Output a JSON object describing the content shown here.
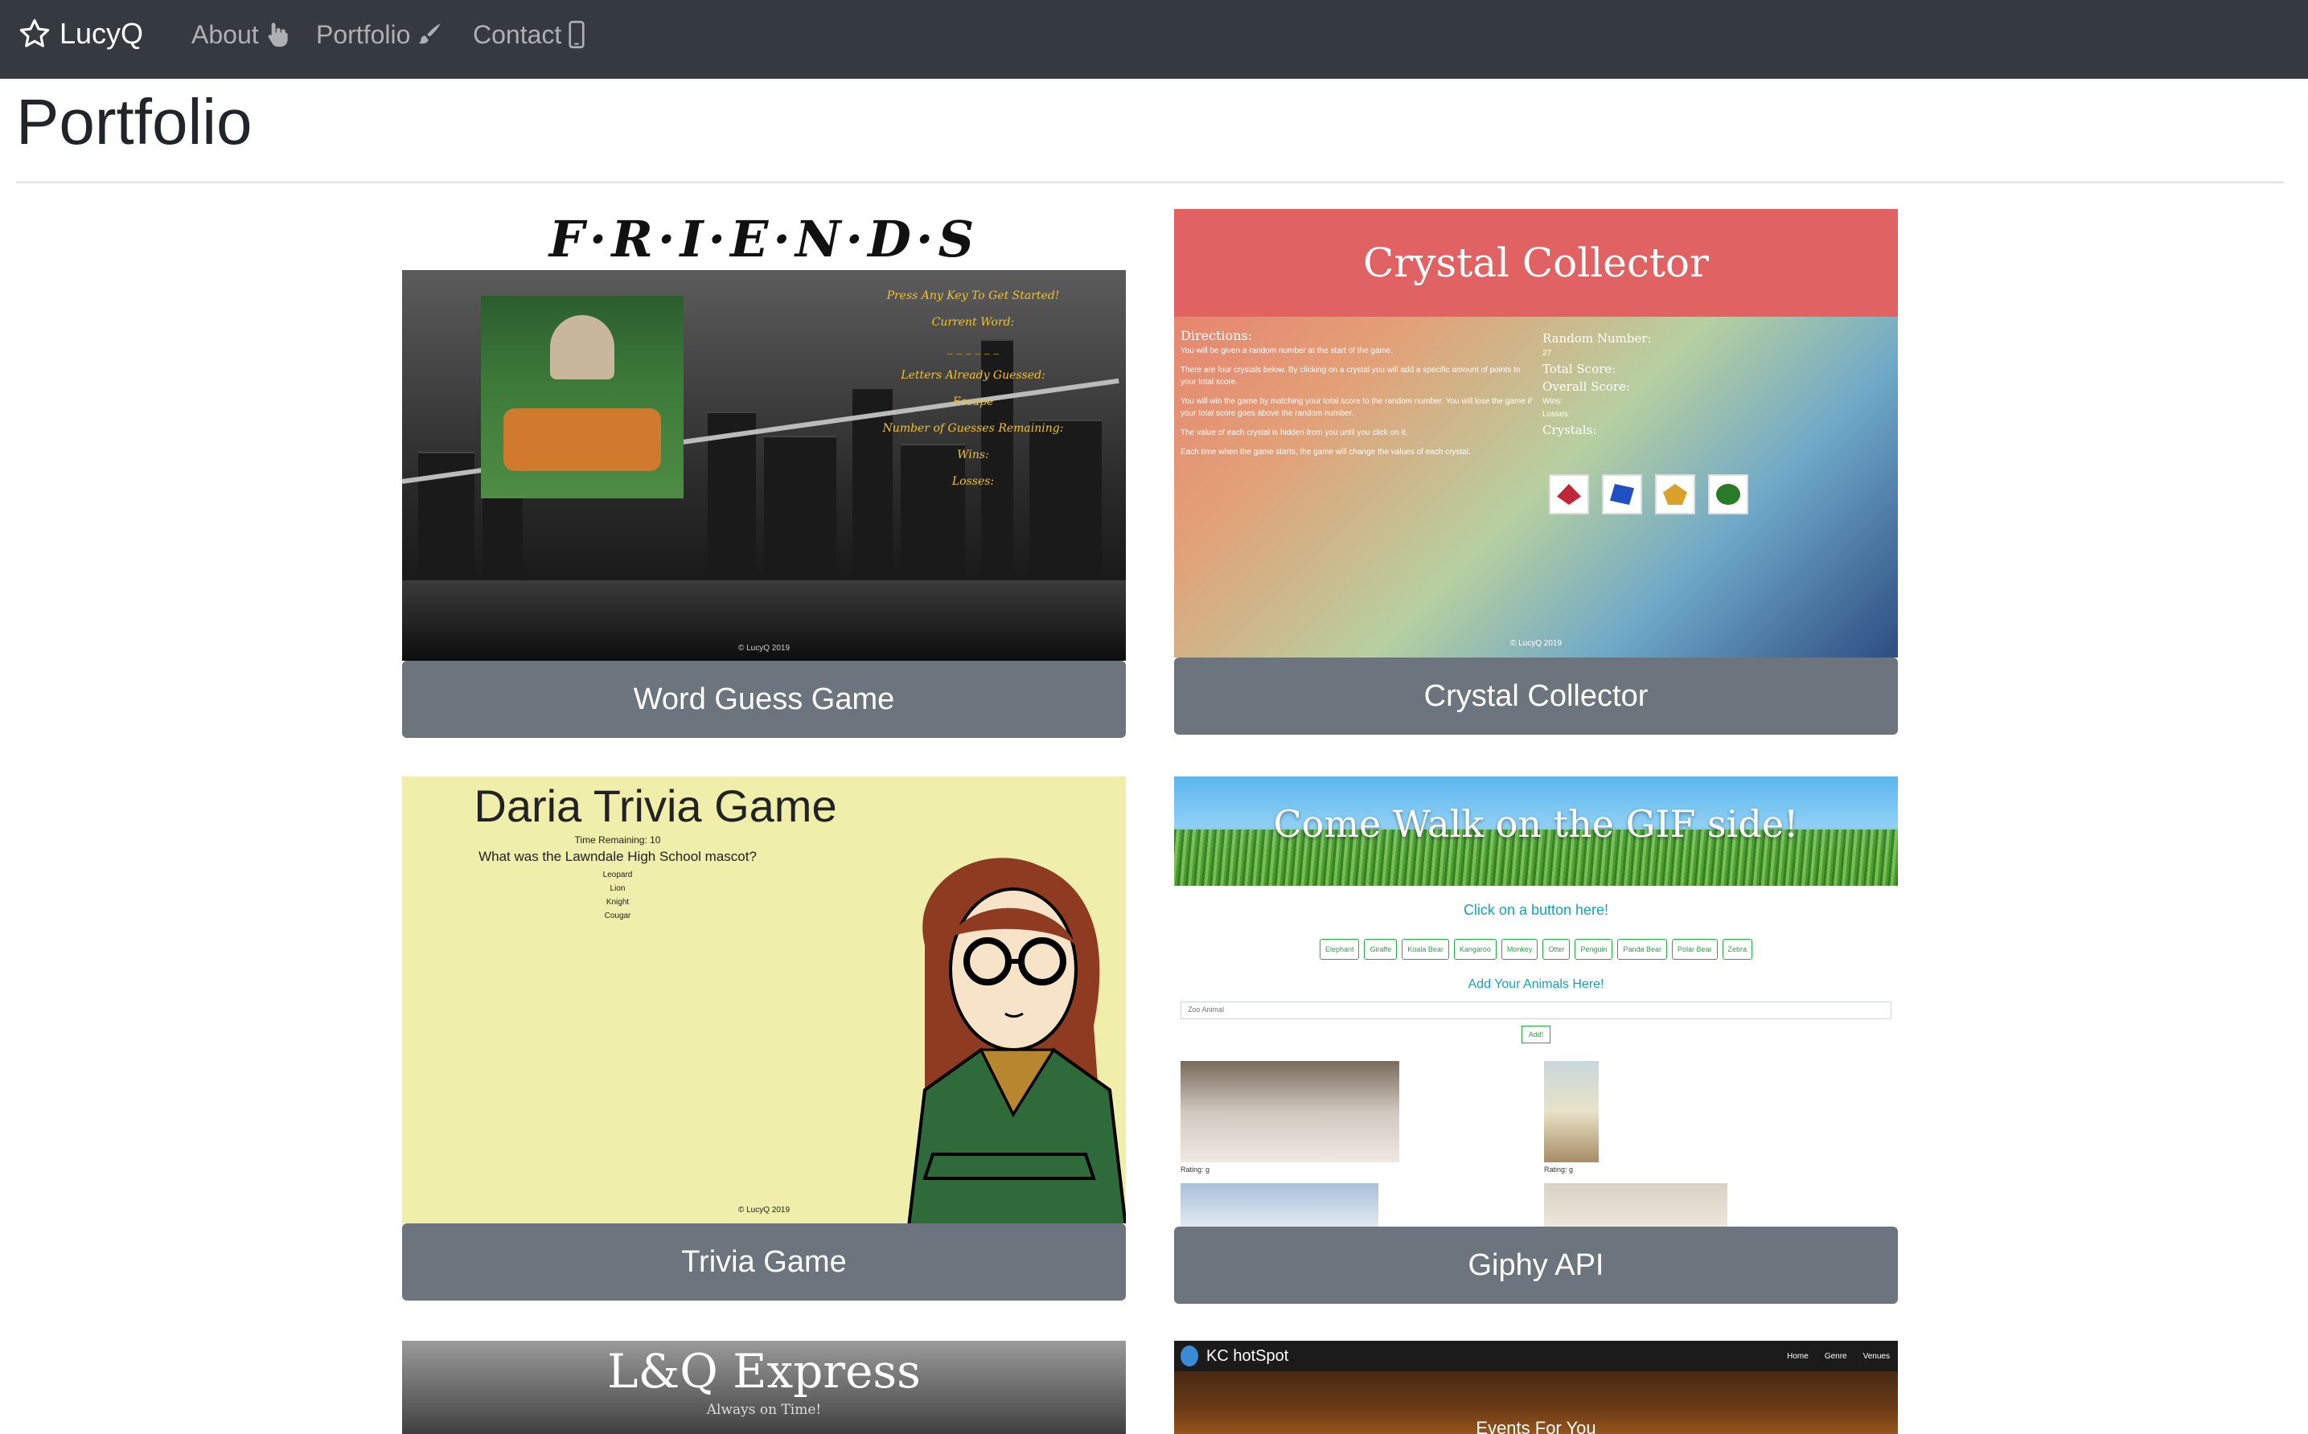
{
  "navbar": {
    "brand": "LucyQ",
    "links": [
      {
        "label": "About",
        "icon": "hand-pointer-icon"
      },
      {
        "label": "Portfolio",
        "icon": "paint-brush-icon"
      },
      {
        "label": "Contact",
        "icon": "mobile-phone-icon"
      }
    ],
    "background": "#343a40"
  },
  "page": {
    "title": "Portfolio"
  },
  "projects": [
    {
      "button": "Word Guess Game",
      "preview": {
        "logo": "F·R·I·E·N·D·S",
        "lines": [
          "Press Any Key To Get Started!",
          "Current Word:",
          "_ _ _ _ _ _",
          "Letters Already Guessed:",
          "Escape",
          "Number of Guesses Remaining:",
          "Wins:",
          "Losses:"
        ],
        "copyright": "© LucyQ 2019"
      }
    },
    {
      "button": "Crystal Collector",
      "preview": {
        "title": "Crystal Collector",
        "directions_heading": "Directions:",
        "directions": [
          "You will be given a random number at the start of the game.",
          "There are four crystals below. By clicking on a crystal you will add a specific amount of points to your total score.",
          "You will win the game by matching your total score to the random number. You will lose the game if your total score goes above the random number.",
          "The value of each crystal is hidden from you until you click on it.",
          "Each time when the game starts, the game will change the values of each crystal."
        ],
        "random_label": "Random Number:",
        "random_value": "27",
        "total_label": "Total Score:",
        "overall_label": "Overall Score:",
        "wins": "Wins:",
        "losses": "Losses:",
        "crystals_label": "Crystals:",
        "copyright": "© LucyQ 2019"
      }
    },
    {
      "button": "Trivia Game",
      "preview": {
        "title": "Daria Trivia Game",
        "time": "Time Remaining: 10",
        "question": "What was the Lawndale High School mascot?",
        "answers": [
          "Leopard",
          "Lion",
          "Knight",
          "Cougar"
        ],
        "copyright": "© LucyQ 2019"
      }
    },
    {
      "button": "Giphy API",
      "preview": {
        "title": "Come Walk on the GIF side!",
        "click_text": "Click on a button here!",
        "animals": [
          "Elephant",
          "Giraffe",
          "Koala Bear",
          "Kangaroo",
          "Monkey",
          "Otter",
          "Penguin",
          "Panda Bear",
          "Polar Bear",
          "Zebra"
        ],
        "add_text": "Add Your Animals Here!",
        "input_placeholder": "Zoo Animal",
        "submit": "Add!",
        "rating": "Rating: g"
      }
    },
    {
      "preview": {
        "title": "L&Q Express",
        "subtitle": "Always on Time!"
      }
    },
    {
      "preview": {
        "brand": "KC hotSpot",
        "links": [
          "Home",
          "Genre",
          "Venues"
        ],
        "hero": "Events For You"
      }
    }
  ]
}
